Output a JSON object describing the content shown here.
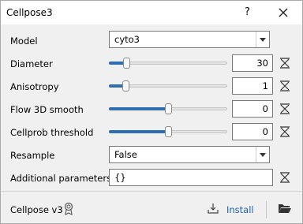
{
  "window": {
    "title": "Cellpose3",
    "help_label": "?"
  },
  "colors": {
    "accent": "#2f6db5",
    "link": "#2060b0"
  },
  "form": {
    "model": {
      "label": "Model",
      "value": "cyto3",
      "icon": "chevron-down-icon"
    },
    "diameter": {
      "label": "Diameter",
      "value": "30",
      "slider_fraction": 0.13,
      "reset_icon": "reset-icon"
    },
    "anisotropy": {
      "label": "Anisotropy",
      "value": "1",
      "slider_fraction": 0.12,
      "reset_icon": "reset-icon"
    },
    "flow3d": {
      "label": "Flow 3D smooth",
      "value": "0",
      "slider_fraction": 0.5,
      "reset_icon": "reset-icon"
    },
    "cellprob": {
      "label": "Cellprob threshold",
      "value": "0",
      "slider_fraction": 0.5,
      "reset_icon": "reset-icon"
    },
    "resample": {
      "label": "Resample",
      "value": "False",
      "icon": "chevron-down-icon"
    },
    "additional": {
      "label": "Additional parameters",
      "value": "{}",
      "reset_icon": "reset-icon"
    }
  },
  "footer": {
    "name": "Cellpose v3",
    "badge_icon": "award-icon",
    "install_icon": "download-icon",
    "install_label": "Install",
    "folder_icon": "folder-open-icon"
  }
}
